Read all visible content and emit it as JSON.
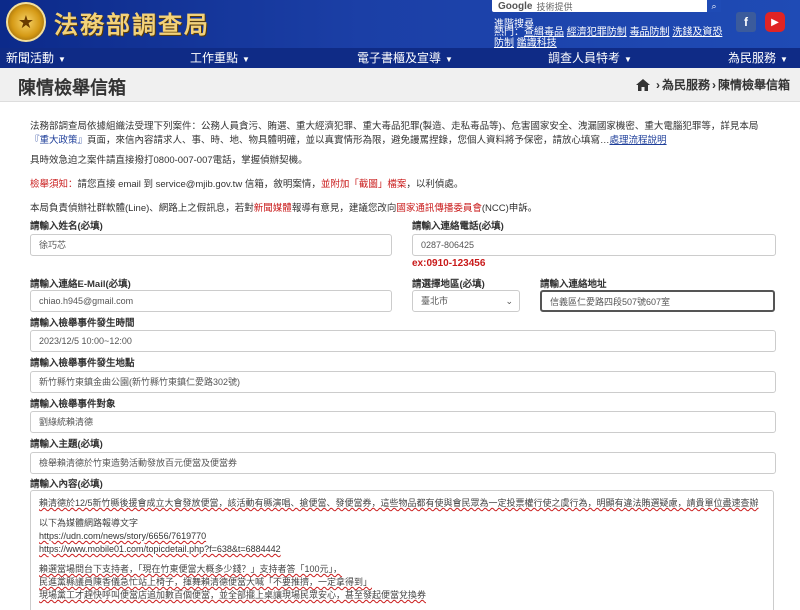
{
  "header": {
    "logo_text": "法務部調查局",
    "search_placeholder": "技術提供",
    "search_brand": "Google",
    "adv_search": "進階搜尋",
    "hot_prefix": "熱門：",
    "hot_items": [
      "查緝毒品",
      "經濟犯罪防制",
      "毒品防制",
      "洗錢及資恐防制",
      "鑑識科技"
    ]
  },
  "nav": {
    "items": [
      "新聞活動",
      "工作重點",
      "電子書櫃及宣導",
      "調查人員特考",
      "為民服務"
    ]
  },
  "title_bar": {
    "title": "陳情檢舉信箱",
    "breadcrumb": [
      "為民服務",
      "陳情檢舉信箱"
    ]
  },
  "intro": {
    "para1": "法務部調查局依據組織法受理下列案件：公務人員貪污、賄選、重大經濟犯罪、重大毒品犯罪(製造、走私毒品等)、危害國家安全、洩漏國家機密、重大電腦犯罪等，詳見本局",
    "para1_link": "『重大政策』",
    "para1_rest": "頁面，來信內容請求人、事、時、地、物具體明確，並以真實情形為限，避免謾罵捏錄，您個人資料將予保密，請放心填寫…",
    "flow_link": "處理流程說明",
    "para2": "具時效急迫之案件請直接撥打0800-007-007電話，掌握偵辦契機。",
    "para3_label": "檢舉須知：",
    "para3_text": "請您直接 email 到 service@mjib.gov.tw 信箱，敘明案情，",
    "para3_red": "並附加「截圖」檔案",
    "para3_end": "，以利偵處。",
    "para4_a": "本局負責偵辦社群軟體(Line)、網路上之假訊息，若對",
    "para4_link1": "新聞媒體",
    "para4_b": "報導有意見，建議您改向",
    "para4_link2": "國家通訊傳播委員會",
    "para4_c": "(NCC)申訴。"
  },
  "form": {
    "name_label": "請輸入姓名(必填)",
    "name_value": "徐巧芯",
    "phone_label": "請輸入連絡電話(必填)",
    "phone_value": "0287-806425",
    "phone_hint": "ex:0910-123456",
    "email_label": "請輸入連絡E-Mail(必填)",
    "email_value": "chiao.h945@gmail.com",
    "region_label": "請選擇地區(必填)",
    "region_value": "臺北市",
    "address_label": "請輸入連絡地址",
    "address_value": "信義區仁愛路四段507號607室",
    "time_label": "請輸入檢舉事件發生時間",
    "time_value": "2023/12/5 10:00~12:00",
    "place_label": "請輸入檢舉事件發生地點",
    "place_value": "新竹縣竹東鎮金曲公園(新竹縣竹東鎮仁愛路302號)",
    "target_label": "請輸入檢舉事件對象",
    "target_value": "劉綠統賴清德",
    "subject_label": "請輸入主題(必填)",
    "subject_value": "檢舉賴清德於竹東造勢活動發放百元便當及便當券",
    "content_label": "請輸入內容(必填)",
    "content_lines": [
      "賴清德於12/5新竹縣後援會成立大會發放便當，該活動有縣演唱、搶便當、發便當券，這些物品都有使與會民眾為一定投票權行使之虞行為，明顯有違法賄選疑慮，請貴單位盡速查辦",
      "",
      "以下為媒體網路報導文字",
      "https://udn.com/news/story/6656/7619770",
      "https://www.mobile01.com/topicdetail.php?f=638&t=6884442",
      "",
      "賴選當場問台下支持者，「現在竹東便當大概多少錢？」支持者答「100元」，",
      "民進黨縣議員陳香儀急忙站上椅子，揮舞賴清德便當大喊「不要推擠，一定拿得到」",
      "現場黨工才趕快呼叫便當店追加數百個便當，並全部擺上桌讓現場民眾安心，甚至發起便當兌換券"
    ]
  }
}
